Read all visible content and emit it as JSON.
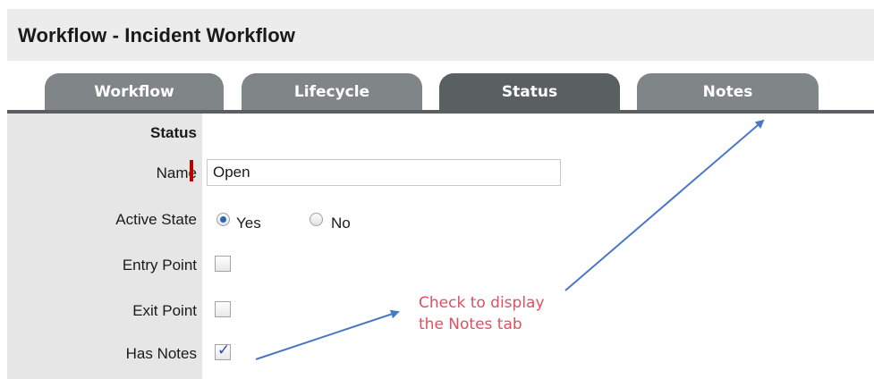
{
  "header": {
    "title": "Workflow - Incident Workflow"
  },
  "tabs": [
    {
      "label": "Workflow",
      "active": false
    },
    {
      "label": "Lifecycle",
      "active": false
    },
    {
      "label": "Status",
      "active": true
    },
    {
      "label": "Notes",
      "active": false
    }
  ],
  "form": {
    "section_heading": "Status",
    "name": {
      "label": "Name",
      "value": "Open",
      "required": true
    },
    "active_state": {
      "label": "Active State",
      "options": [
        "Yes",
        "No"
      ],
      "selected": "Yes"
    },
    "entry_point": {
      "label": "Entry Point",
      "checked": false
    },
    "exit_point": {
      "label": "Exit Point",
      "checked": false
    },
    "has_notes": {
      "label": "Has Notes",
      "checked": true,
      "check_glyph": "✓"
    }
  },
  "annotation": {
    "line1": "Check to display",
    "line2": "the Notes tab",
    "color": "#e05060"
  },
  "colors": {
    "tab_active": "#5a5f62",
    "tab_inactive": "#808588",
    "required": "#c00000",
    "arrow": "#4a78c8"
  },
  "icons": {
    "required_marker": "required-marker-icon",
    "arrow": "arrow-icon"
  }
}
